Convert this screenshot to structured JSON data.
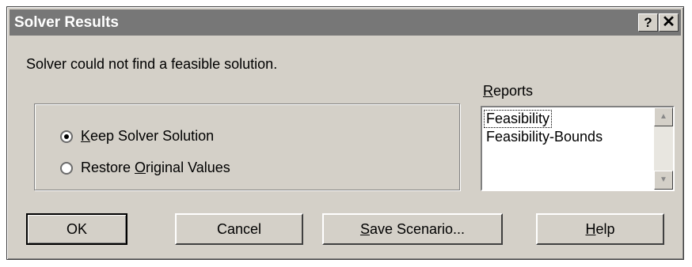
{
  "dialog": {
    "title": "Solver Results",
    "help_button": "?",
    "close_button": "✕"
  },
  "message": "Solver could not find a feasible solution.",
  "options": [
    {
      "pre": "",
      "accel": "K",
      "post": "eep Solver Solution",
      "checked": true
    },
    {
      "pre": "Restore ",
      "accel": "O",
      "post": "riginal Values",
      "checked": false
    }
  ],
  "reports": {
    "label_accel": "R",
    "label_rest": "eports",
    "items": [
      "Feasibility",
      "Feasibility-Bounds"
    ],
    "selected_index": 0
  },
  "buttons": {
    "ok": "OK",
    "cancel": "Cancel",
    "save_accel": "S",
    "save_rest": "ave Scenario...",
    "help_accel": "H",
    "help_rest": "elp"
  }
}
